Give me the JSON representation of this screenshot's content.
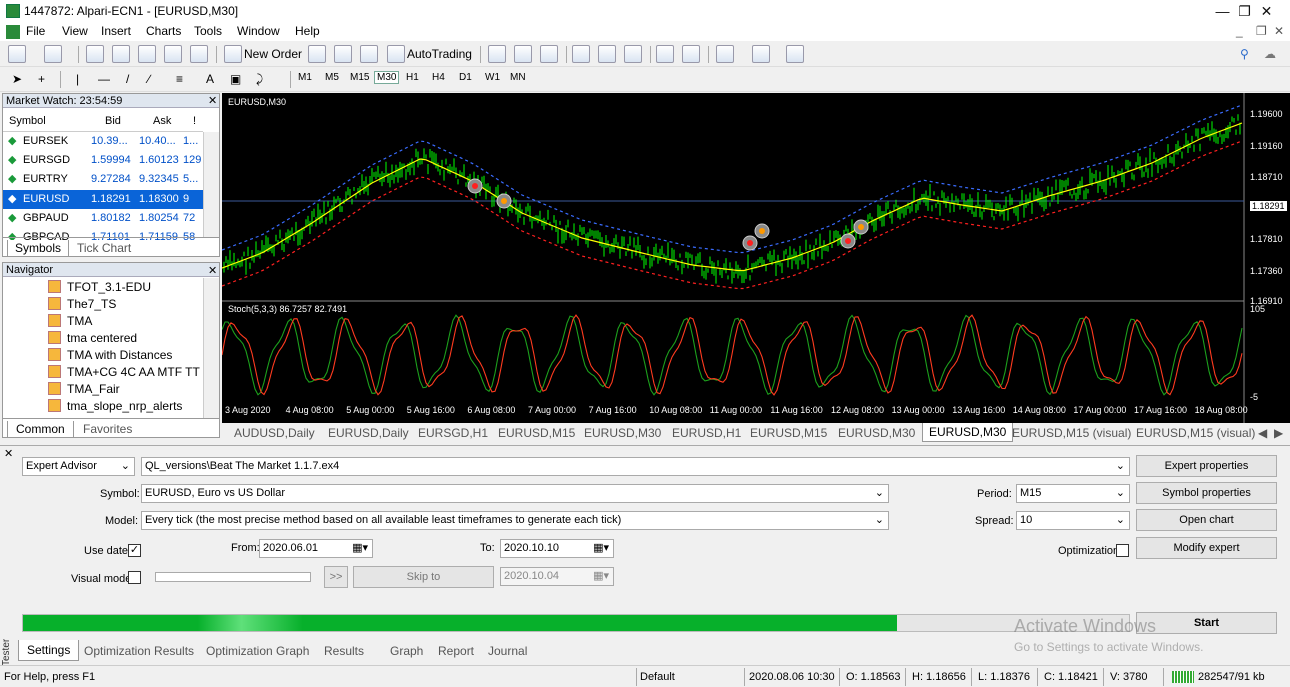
{
  "window": {
    "title": "1447872: Alpari-ECN1 - [EURUSD,M30]"
  },
  "menu": [
    "File",
    "View",
    "Insert",
    "Charts",
    "Tools",
    "Window",
    "Help"
  ],
  "toolbar": {
    "new_order": "New Order",
    "autotrading": "AutoTrading",
    "text_tool": "A",
    "timeframes": [
      "M1",
      "M5",
      "M15",
      "M30",
      "H1",
      "H4",
      "D1",
      "W1",
      "MN"
    ]
  },
  "market_watch": {
    "title": "Market Watch: 23:54:59",
    "columns": [
      "Symbol",
      "Bid",
      "Ask",
      "!"
    ],
    "rows": [
      {
        "symbol": "EURSEK",
        "bid": "10.39...",
        "ask": "10.40...",
        "spread": "1..."
      },
      {
        "symbol": "EURSGD",
        "bid": "1.59994",
        "ask": "1.60123",
        "spread": "129"
      },
      {
        "symbol": "EURTRY",
        "bid": "9.27284",
        "ask": "9.32345",
        "spread": "5..."
      },
      {
        "symbol": "EURUSD",
        "bid": "1.18291",
        "ask": "1.18300",
        "spread": "9"
      },
      {
        "symbol": "GBPAUD",
        "bid": "1.80182",
        "ask": "1.80254",
        "spread": "72"
      },
      {
        "symbol": "GBPCAD",
        "bid": "1.71101",
        "ask": "1.71159",
        "spread": "58"
      }
    ],
    "tabs": [
      "Symbols",
      "Tick Chart"
    ]
  },
  "navigator": {
    "title": "Navigator",
    "items": [
      "TFOT_3.1-EDU",
      "The7_TS",
      "TMA",
      "tma centered",
      "TMA with Distances",
      "TMA+CG 4C AA MTF TT",
      "TMA_Fair",
      "tma_slope_nrp_alerts"
    ],
    "tabs": [
      "Common",
      "Favorites"
    ]
  },
  "chart": {
    "title": "EURUSD,M30",
    "stoch_label": "Stoch(5,3,3) 86.7257 82.7491",
    "price_labels": [
      "1.19600",
      "1.19160",
      "1.18710",
      "1.18291",
      "1.17810",
      "1.17360",
      "1.16910"
    ],
    "stoch_labels": [
      "105",
      "-5"
    ],
    "time_labels": [
      "3 Aug 2020",
      "4 Aug 08:00",
      "5 Aug 00:00",
      "5 Aug 16:00",
      "6 Aug 08:00",
      "7 Aug 00:00",
      "7 Aug 16:00",
      "10 Aug 08:00",
      "11 Aug 00:00",
      "11 Aug 16:00",
      "12 Aug 08:00",
      "13 Aug 00:00",
      "13 Aug 16:00",
      "14 Aug 08:00",
      "17 Aug 00:00",
      "17 Aug 16:00",
      "18 Aug 08:00"
    ],
    "colors": {
      "bull": "#00ff00",
      "ma": "#ffff00",
      "upper": "#3a6cff",
      "lower": "#ff2020",
      "stoch_main": "#ff3b1f",
      "stoch_signal": "#1ca01c"
    }
  },
  "chart_tabs": [
    "AUDUSD,Daily",
    "EURUSD,Daily",
    "EURSGD,H1",
    "EURUSD,M15",
    "EURUSD,M30",
    "EURUSD,H1",
    "EURUSD,M15",
    "EURUSD,M30",
    "EURUSD,M30",
    "EURUSD,M15 (visual)",
    "EURUSD,M15 (visual)"
  ],
  "tester": {
    "type": "Expert Advisor",
    "ea_path": "QL_versions\\Beat The Market 1.1.7.ex4",
    "symbol_label": "Symbol:",
    "symbol": "EURUSD, Euro vs US Dollar",
    "model_label": "Model:",
    "model": "Every tick (the most precise method based on all available least timeframes to generate each tick)",
    "use_date_label": "Use date",
    "from_label": "From:",
    "from": "2020.06.01",
    "to_label": "To:",
    "to": "2020.10.10",
    "visual_mode_label": "Visual mode",
    "skip_btn": "Skip to",
    "skip_date": "2020.10.04",
    "fwd_btn": ">>",
    "period_label": "Period:",
    "period": "M15",
    "spread_label": "Spread:",
    "spread": "10",
    "optimization_label": "Optimization",
    "buttons": {
      "expert_properties": "Expert properties",
      "symbol_properties": "Symbol properties",
      "open_chart": "Open chart",
      "modify_expert": "Modify expert",
      "start": "Start"
    },
    "progress": 0.79,
    "tabs": [
      "Settings",
      "Optimization Results",
      "Optimization Graph",
      "Results",
      "Graph",
      "Report",
      "Journal"
    ],
    "side_label": "Tester",
    "watermark_1": "Activate Windows",
    "watermark_2": "Go to Settings to activate Windows."
  },
  "status": {
    "help": "For Help, press F1",
    "profile": "Default",
    "time": "2020.08.06 10:30",
    "open": "O: 1.18563",
    "high": "H: 1.18656",
    "low": "L: 1.18376",
    "close": "C: 1.18421",
    "volume": "V: 3780",
    "traffic": "282547/91 kb"
  }
}
